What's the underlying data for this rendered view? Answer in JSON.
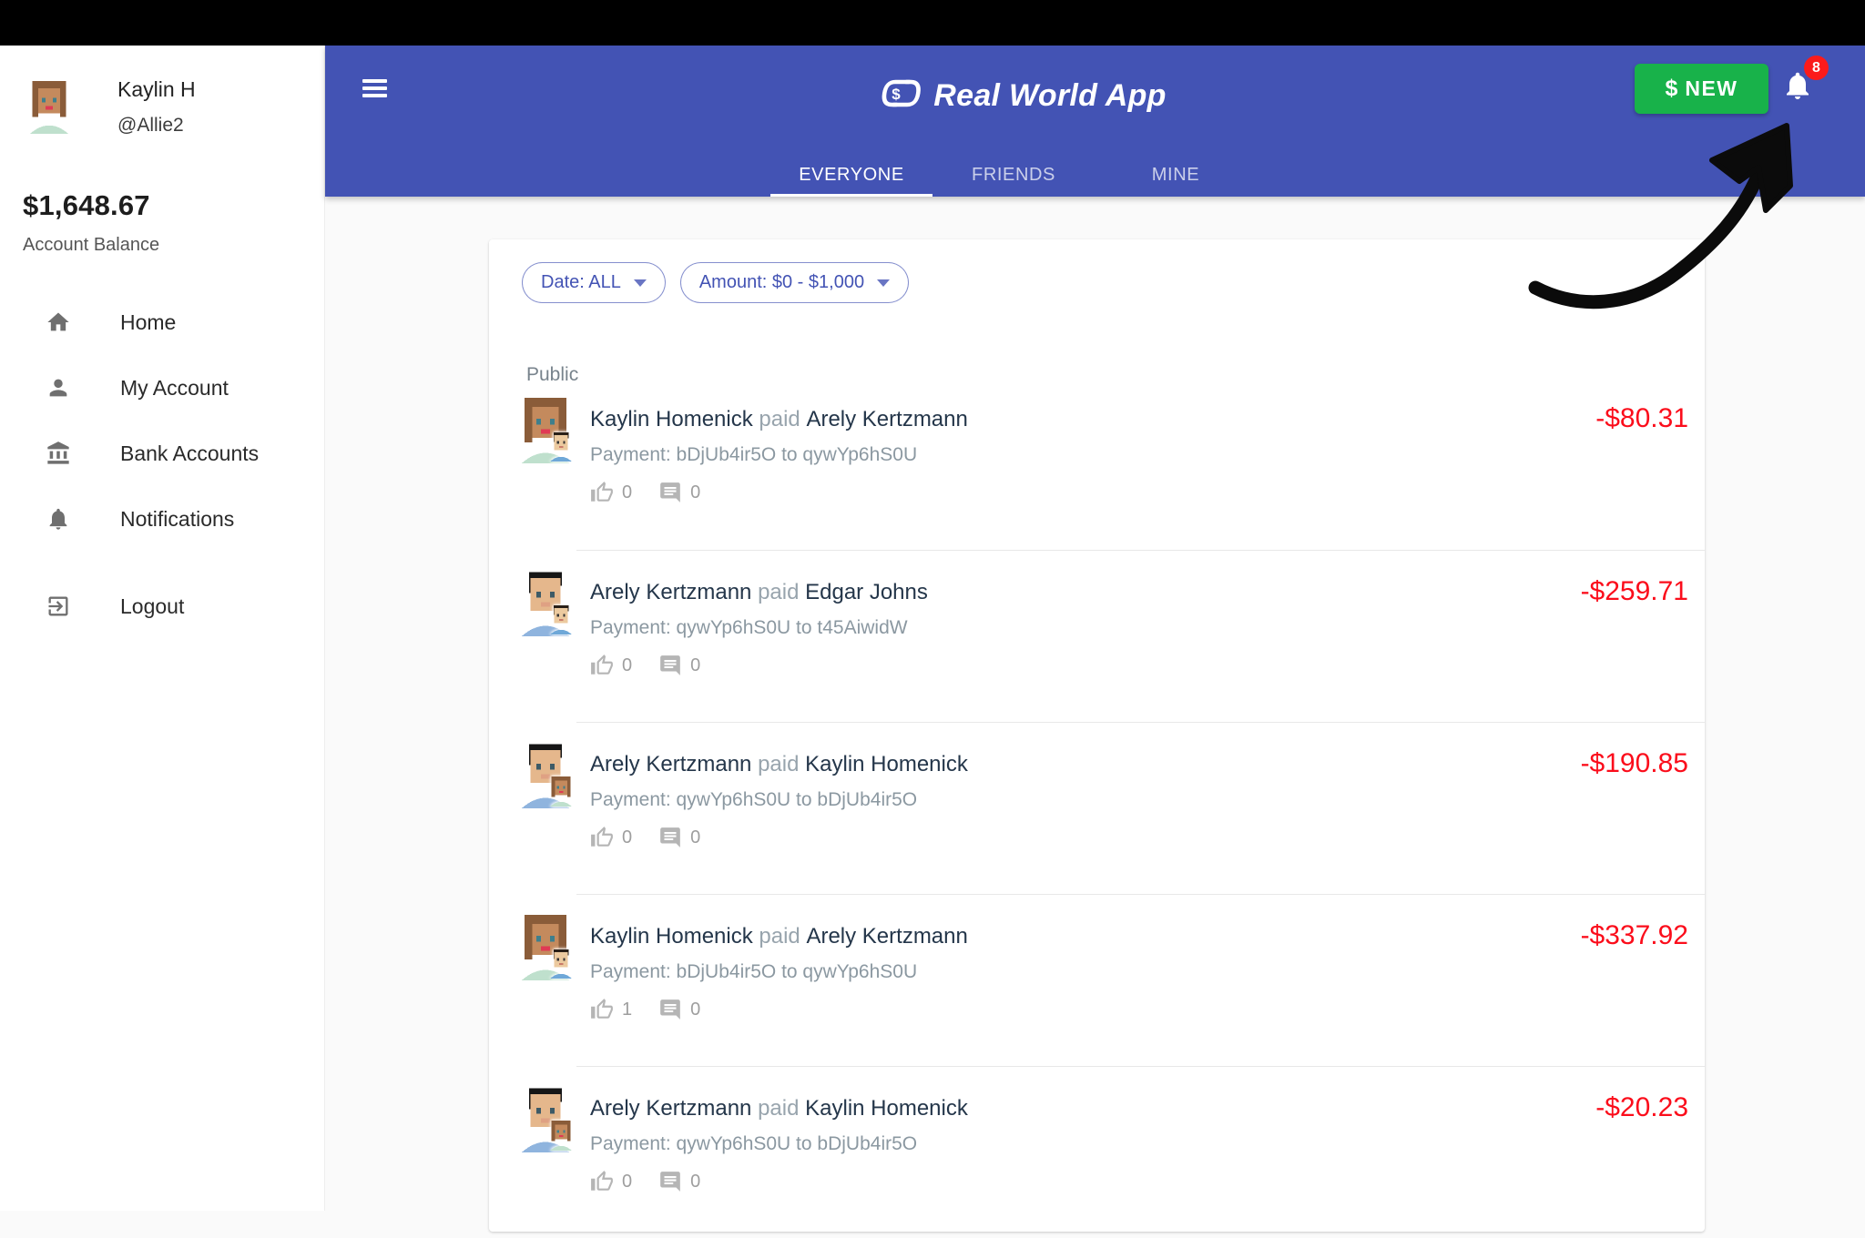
{
  "colors": {
    "header_indigo": "#4353b4",
    "new_button_green": "#18b24a",
    "amount_negative_red": "#fb0d1b",
    "badge_red": "#fb1b1b"
  },
  "sidebar": {
    "user": {
      "name": "Kaylin H",
      "username": "@Allie2"
    },
    "balance": {
      "amount": "$1,648.67",
      "label": "Account Balance"
    },
    "items": [
      {
        "label": "Home",
        "icon": "home-icon"
      },
      {
        "label": "My Account",
        "icon": "person-icon"
      },
      {
        "label": "Bank Accounts",
        "icon": "bank-icon"
      },
      {
        "label": "Notifications",
        "icon": "bell-icon"
      },
      {
        "label": "Logout",
        "icon": "logout-icon"
      }
    ]
  },
  "header": {
    "title": "Real World App",
    "logo_icon": "dollar-link-logo",
    "tabs": [
      {
        "label": "EVERYONE",
        "active": true
      },
      {
        "label": "FRIENDS",
        "active": false
      },
      {
        "label": "MINE",
        "active": false
      }
    ],
    "new_button": {
      "icon": "$",
      "label": "NEW"
    },
    "notifications_count": "8"
  },
  "filters": {
    "date_label": "Date: ALL",
    "amount_label": "Amount: $0 - $1,000"
  },
  "feed": {
    "section_label": "Public",
    "transactions": [
      {
        "sender": "Kaylin Homenick",
        "action": "paid",
        "receiver": "Arely Kertzmann",
        "description": "Payment: bDjUb4ir5O to qywYp6hS0U",
        "likes": "0",
        "comments": "0",
        "amount": "-$80.31",
        "avatar": {
          "main": "woman",
          "mini": "boy"
        }
      },
      {
        "sender": "Arely Kertzmann",
        "action": "paid",
        "receiver": "Edgar Johns",
        "description": "Payment: qywYp6hS0U to t45AiwidW",
        "likes": "0",
        "comments": "0",
        "amount": "-$259.71",
        "avatar": {
          "main": "man",
          "mini": "boy"
        }
      },
      {
        "sender": "Arely Kertzmann",
        "action": "paid",
        "receiver": "Kaylin Homenick",
        "description": "Payment: qywYp6hS0U to bDjUb4ir5O",
        "likes": "0",
        "comments": "0",
        "amount": "-$190.85",
        "avatar": {
          "main": "man",
          "mini": "woman"
        }
      },
      {
        "sender": "Kaylin Homenick",
        "action": "paid",
        "receiver": "Arely Kertzmann",
        "description": "Payment: bDjUb4ir5O to qywYp6hS0U",
        "likes": "1",
        "comments": "0",
        "amount": "-$337.92",
        "avatar": {
          "main": "woman",
          "mini": "boy"
        }
      },
      {
        "sender": "Arely Kertzmann",
        "action": "paid",
        "receiver": "Kaylin Homenick",
        "description": "Payment: qywYp6hS0U to bDjUb4ir5O",
        "likes": "0",
        "comments": "0",
        "amount": "-$20.23",
        "avatar": {
          "main": "man",
          "mini": "woman"
        }
      }
    ]
  },
  "avatar_palettes": {
    "woman": {
      "hair": "#8a5c39",
      "skin": "#c48a5d",
      "shirt": "#bfe0cd",
      "lip": "#e03a54",
      "eye": "#3f7f8c"
    },
    "man": {
      "hair": "#161616",
      "skin": "#e5b78c",
      "shirt": "#8fb4de",
      "lip": "#dfa183",
      "eye": "#3d5a66"
    },
    "boy": {
      "hair": "#2a2018",
      "skin": "#ecca9f",
      "shirt": "#6fa8d8",
      "lip": "#c97b6a",
      "eye": "#333333"
    }
  }
}
